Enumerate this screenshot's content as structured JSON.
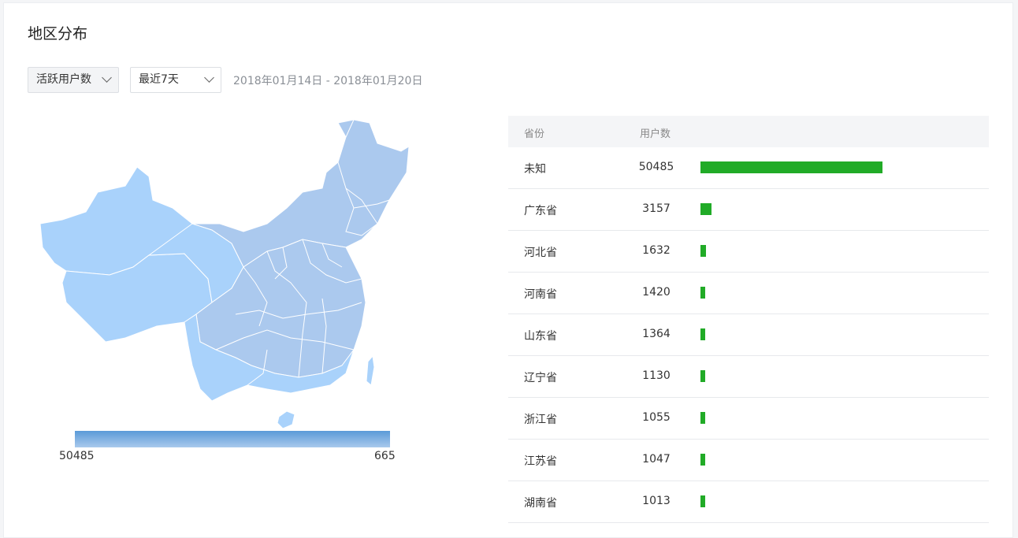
{
  "header": {
    "title": "地区分布"
  },
  "filters": {
    "metric": "活跃用户数",
    "period": "最近7天",
    "date_range": "2018年01月14日 - 2018年01月20日"
  },
  "map": {
    "legend_min": "50485",
    "legend_max": "665",
    "fill_colors": {
      "low": "#a9d2fb",
      "mid": "#abc9ee",
      "high": "#5a9ad7"
    }
  },
  "table": {
    "columns": [
      "省份",
      "用户数"
    ],
    "bar_color": "#21ab27",
    "max": 50485,
    "rows": [
      {
        "province": "未知",
        "users": 50485
      },
      {
        "province": "广东省",
        "users": 3157
      },
      {
        "province": "河北省",
        "users": 1632
      },
      {
        "province": "河南省",
        "users": 1420
      },
      {
        "province": "山东省",
        "users": 1364
      },
      {
        "province": "辽宁省",
        "users": 1130
      },
      {
        "province": "浙江省",
        "users": 1055
      },
      {
        "province": "江苏省",
        "users": 1047
      },
      {
        "province": "湖南省",
        "users": 1013
      }
    ]
  }
}
